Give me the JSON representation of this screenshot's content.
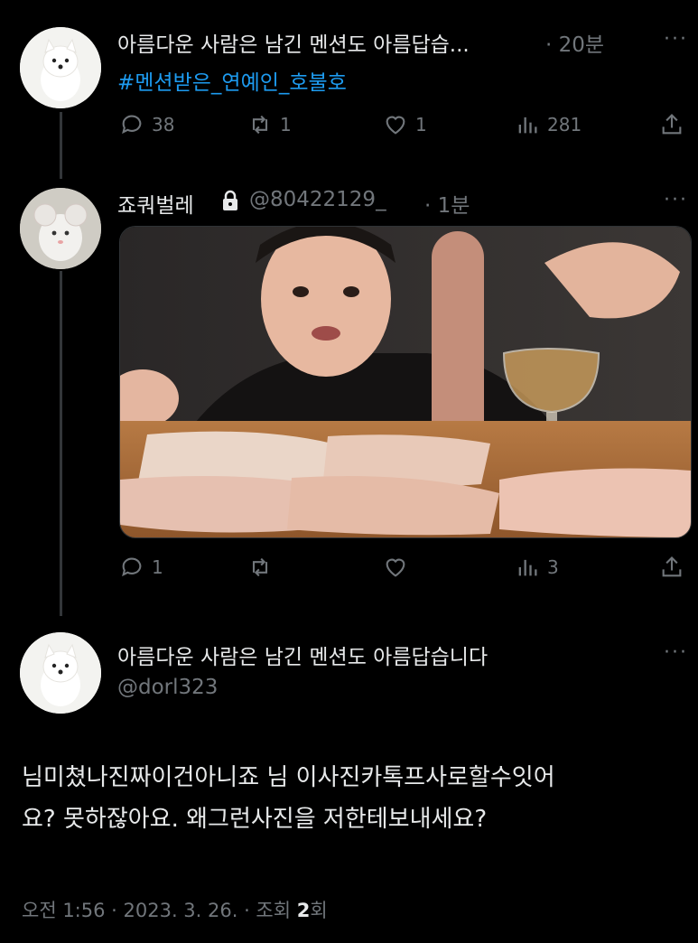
{
  "tweet1": {
    "name": "아름다운 사람은 남긴 멘션도 아름답습...",
    "time": "· 20분",
    "hashtag": "#멘션받은_연예인_호불호",
    "more": "···",
    "replies": "38",
    "retweets": "1",
    "likes": "1",
    "views": "281"
  },
  "tweet2": {
    "name": "죠쿼벌레",
    "handle": "@80422129_",
    "time": "· 1분",
    "more": "···",
    "replies": "1",
    "retweets": "",
    "likes": "",
    "views": "3"
  },
  "main": {
    "name": "아름다운 사람은 남긴 멘션도 아름답습니다",
    "handle": "@dorl323",
    "more": "···",
    "text_line1": "님미쳤나진짜이건아니죠 님 이사진카톡프사로할수잇어",
    "text_line2": "요? 못하잖아요. 왜그런사진을 저한테보내세요?",
    "footer_time": "오전 1:56 · 2023. 3. 26. · 조회 ",
    "footer_views": "2",
    "footer_suffix": "회"
  }
}
